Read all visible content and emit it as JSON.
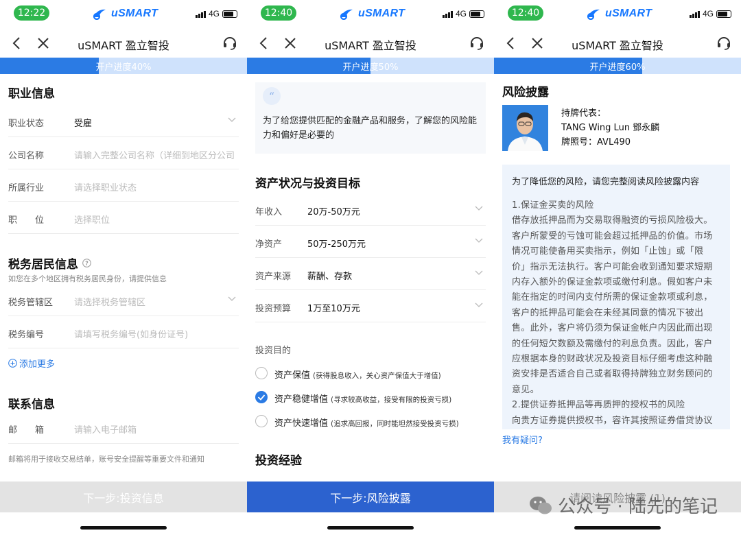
{
  "brand": {
    "name": "uSMART",
    "network": "4G",
    "logo_icon": "usmart-logo-icon",
    "color": "#1677ff"
  },
  "nav_title": "uSMART 盈立智投",
  "colors": {
    "progress": "#2b7be4",
    "progress_track": "#cfe2fc",
    "status_time_bg": "#2fb74e",
    "checked": "#2b7be4"
  },
  "screen1": {
    "time": "12:22",
    "progress_label": "开户进度40%",
    "progress_value": 0.4,
    "career": {
      "title": "职业信息",
      "fields": [
        {
          "label": "职业状态",
          "value": "受雇",
          "placeholder": ""
        },
        {
          "label": "公司名称",
          "value": "",
          "placeholder": "请输入完整公司名称（详细到地区分公司"
        },
        {
          "label": "所属行业",
          "value": "",
          "placeholder": "请选择职业状态"
        },
        {
          "label": "职　　位",
          "value": "",
          "placeholder": "选择职位"
        }
      ]
    },
    "tax": {
      "title": "税务居民信息",
      "hint": "如您在多个地区拥有税务居民身份，请提供信息",
      "fields": [
        {
          "label": "税务管辖区",
          "placeholder": "请选择税务管辖区"
        },
        {
          "label": "税务编号",
          "placeholder": "请填写税务编号(如身份证号)"
        }
      ],
      "add_more": "添加更多"
    },
    "contact": {
      "title": "联系信息",
      "fields": [
        {
          "label": "邮　　箱",
          "placeholder": "请输入电子邮箱"
        }
      ],
      "hint": "邮箱将用于接收交易结单，账号安全提醒等重要文件和通知"
    },
    "next_button": "下一步:投资信息"
  },
  "screen2": {
    "time": "12:40",
    "progress_label": "开户进度50%",
    "progress_value": 0.5,
    "intro": "为了给您提供匹配的金融产品和服务，了解您的风险能力和偏好是必要的",
    "assets": {
      "title": "资产状况与投资目标",
      "fields": [
        {
          "label": "年收入",
          "value": "20万-50万元"
        },
        {
          "label": "净资产",
          "value": "50万-250万元"
        },
        {
          "label": "资产来源",
          "value": "薪酬、存款"
        },
        {
          "label": "投资预算",
          "value": "1万至10万元"
        }
      ]
    },
    "purpose": {
      "title": "投资目的",
      "options": [
        {
          "label": "资产保值",
          "desc": "(获得股息收入，关心资产保值大于增值)",
          "checked": false
        },
        {
          "label": "资产稳健增值",
          "desc": "(寻求较高收益，接受有限的投资亏损)",
          "checked": true
        },
        {
          "label": "资产快速增值",
          "desc": "(追求高回报，同时能坦然接受投资亏损)",
          "checked": false
        }
      ]
    },
    "experience_title": "投资经验",
    "next_button": "下一步:风险披露"
  },
  "screen3": {
    "time": "12:40",
    "progress_label": "开户进度60%",
    "progress_value": 0.6,
    "title": "风险披露",
    "rep": {
      "label": "持牌代表：",
      "name": "TANG Wing Lun 鄧永麟",
      "license": "牌照号：AVL490"
    },
    "notice": "为了降低您的风险，请您完整阅读风险披露内容",
    "body_lines": [
      "1.保证金买卖的风险",
      "借存放抵押品而为交易取得融资的亏损风险极大。",
      "客户所蒙受的亏蚀可能会超过抵押品的价值。市场",
      "情况可能使备用买卖指示，例如「止蚀」或「限",
      "价」指示无法执行。客户可能会收到通知要求短期",
      "内存入额外的保证金款项或缴付利息。假如客户未",
      "能在指定的时间内支付所需的保证金款项或利息，",
      "客户的抵押品可能会在未经其同意的情况下被出",
      "售。此外，客户将仍须为保证金帐户内因此而出现",
      "的任何短欠数额及需缴付的利息负责。因此，客户",
      "应根据本身的财政状况及投资目标仔细考虑这种融",
      "资安排是否适合自己或者取得持牌独立财务顾问的",
      "意见。",
      "2.提供证券抵押品等再质押的授权书的风险",
      "向贵方证券提供授权书，容许其按照证券借贷协议"
    ],
    "question_link": "我有疑问?",
    "read_button": "请阅读风险披露 (1)"
  },
  "watermark": {
    "text": "公众号 · 陆先的笔记",
    "icon": "wechat-icon"
  }
}
